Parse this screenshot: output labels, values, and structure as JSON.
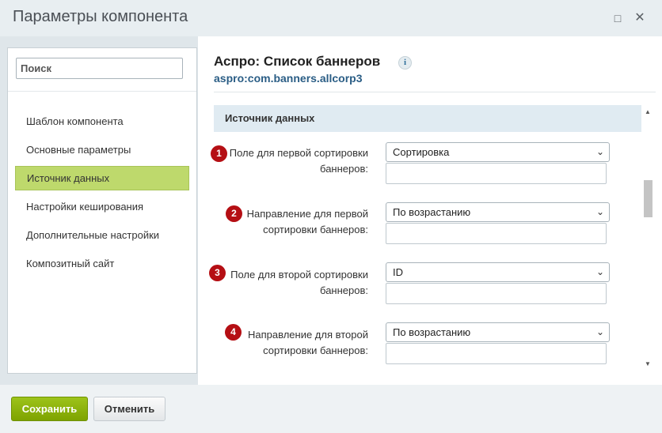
{
  "window": {
    "title": "Параметры компонента",
    "minimize_icon": "□",
    "close_icon": "✕"
  },
  "sidebar": {
    "search_placeholder": "Поиск",
    "items": [
      {
        "label": "Шаблон компонента",
        "active": false
      },
      {
        "label": "Основные параметры",
        "active": false
      },
      {
        "label": "Источник данных",
        "active": true
      },
      {
        "label": "Настройки кеширования",
        "active": false
      },
      {
        "label": "Дополнительные настройки",
        "active": false
      },
      {
        "label": "Композитный сайт",
        "active": false
      }
    ]
  },
  "component": {
    "title": "Аспро: Список баннеров",
    "info_icon": "i",
    "id": "aspro:com.banners.allcorp3"
  },
  "section": {
    "title": "Источник данных"
  },
  "fields": [
    {
      "badge": "1",
      "label_line1": "Поле для первой сортировки",
      "label_line2": "баннеров:",
      "value": "Сортировка"
    },
    {
      "badge": "2",
      "label_line1": "Направление для первой",
      "label_line2": "сортировки баннеров:",
      "value": "По возрастанию"
    },
    {
      "badge": "3",
      "label_line1": "Поле для второй сортировки",
      "label_line2": "баннеров:",
      "value": "ID"
    },
    {
      "badge": "4",
      "label_line1": "Направление для второй",
      "label_line2": "сортировки баннеров:",
      "value": "По возрастанию"
    }
  ],
  "scrollbar": {
    "up_icon": "▲",
    "down_icon": "▼"
  },
  "footer": {
    "save_label": "Сохранить",
    "cancel_label": "Отменить"
  },
  "colors": {
    "accent_green": "#86ad00",
    "active_nav": "#bed96c",
    "badge_red": "#b50f14",
    "link_blue": "#2a5d85"
  },
  "icons": [
    "minimize-icon",
    "close-icon",
    "info-icon",
    "chevron-down-icon",
    "scroll-up-icon",
    "scroll-down-icon"
  ]
}
